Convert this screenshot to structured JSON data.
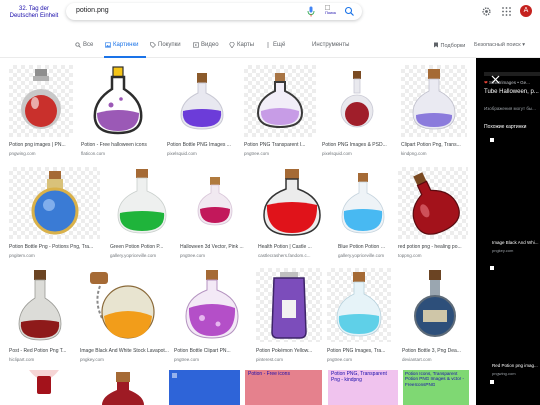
{
  "header": {
    "logo_alt": "32. Tag der Deutschen Einheit",
    "query": "potion.png",
    "lens_alt": "Поиск",
    "avatar_letter": "A"
  },
  "tabs": [
    {
      "label": "Все",
      "icon": "search-icon"
    },
    {
      "label": "Картинки",
      "icon": "image-icon"
    },
    {
      "label": "Покупки",
      "icon": "tag-icon"
    },
    {
      "label": "Видео",
      "icon": "video-icon"
    },
    {
      "label": "Карты",
      "icon": "map-pin-icon"
    },
    {
      "label": "Ещё",
      "icon": "more-dots-icon"
    },
    {
      "label": "Инструменты",
      "icon": ""
    }
  ],
  "right_tools": {
    "collections": "Подборки",
    "safesearch": "Безопасный поиск"
  },
  "results": [
    {
      "title": "Potion png images | PN...",
      "source": "pngwing.com"
    },
    {
      "title": "Potion - Free halloween icons",
      "source": "flaticon.com"
    },
    {
      "title": "Potion Bottle PNG Images ...",
      "source": "pixelsquid.com"
    },
    {
      "title": "Potion PNG Transparent I...",
      "source": "pngtree.com"
    },
    {
      "title": "Potion PNG Images & PSD...",
      "source": "pixelsquid.com"
    },
    {
      "title": "Clipart Potion Png, Trans...",
      "source": "kindpng.com"
    },
    {
      "title": "Potion Bottle Png - Potions Png, Tra...",
      "source": "pngitem.com"
    },
    {
      "title": "Green Potion Potion P...",
      "source": "gallery.yopriceville.com"
    },
    {
      "title": "Halloween 3d Vector, Pink ...",
      "source": "pngtree.com"
    },
    {
      "title": "Health Potion | Castle ...",
      "source": "castlecrashers.fandom.c..."
    },
    {
      "title": "Blue Potion Potion PN...",
      "source": "gallery.yopriceville.com"
    },
    {
      "title": "red potion png - healing po...",
      "source": "toppng.com"
    },
    {
      "title": "Post - Red Potion Png T...",
      "source": "hiclipart.com"
    },
    {
      "title": "Image Black And White Stock Lavapot...",
      "source": "pngkey.com"
    },
    {
      "title": "Potion Bottle Clipart PN...",
      "source": "pngtree.com"
    },
    {
      "title": "Potion Pokémon Yellow...",
      "source": "pinterest.com"
    },
    {
      "title": "Potion PNG Images, Tra...",
      "source": "pngtree.com"
    },
    {
      "title": "Potion Bottle 3, Png Dea...",
      "source": "deviantart.com"
    }
  ],
  "row4_broken": [
    "Potion - Free icons",
    "Potion PNG, Transparent Png - kindpng",
    "Potion Icons, Transparent Potion PNG Images & vctor - FreeIconsPNG"
  ],
  "panel": {
    "site": "Sinistrimages • Ge...",
    "title": "Tube Halloween, p...",
    "subtitle": "Изображения могут бы...",
    "similar": "Похожие картинки",
    "item1_title": "Image Black And Whi...",
    "item1_source": "pngkey.com",
    "item2_title": "Red Potion png imag...",
    "item2_source": "pngwing.com"
  },
  "colors": {
    "accent": "#1a73e8",
    "avatar": "#c5221f",
    "panel_bg": "#000000"
  }
}
